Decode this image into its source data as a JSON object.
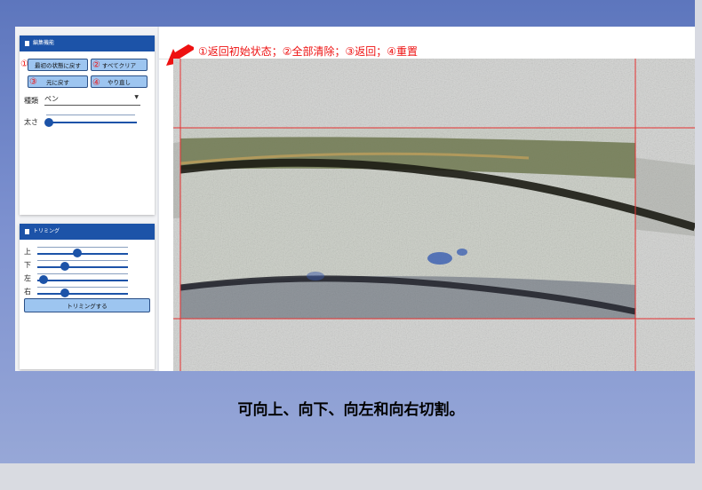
{
  "panel_edit": {
    "title": "編集機能",
    "buttons": {
      "reset": "最初の状態に戻す",
      "clear_all": "すべてクリア",
      "undo": "元に戻す",
      "redo": "やり直し"
    },
    "markers": [
      "①",
      "②",
      "③",
      "④"
    ],
    "type_label": "種類",
    "type_value": "ペン",
    "thickness_label": "太さ",
    "thickness_level": 0.05
  },
  "panel_trim": {
    "title": "トリミング",
    "sliders": [
      {
        "label": "上",
        "value": 0.4
      },
      {
        "label": "下",
        "value": 0.27
      },
      {
        "label": "左",
        "value": 0.05
      },
      {
        "label": "右",
        "value": 0.27
      }
    ],
    "button": "トリミングする"
  },
  "annotation": "①返回初始状态；②全部清除；③返回；④重置",
  "caption": "可向上、向下、向左和向右切割。",
  "colors": {
    "header_blue": "#1c53a8",
    "button_blue": "#9dc5f0",
    "annotation_red": "#e11111",
    "crop_line_red": "#e53030"
  }
}
